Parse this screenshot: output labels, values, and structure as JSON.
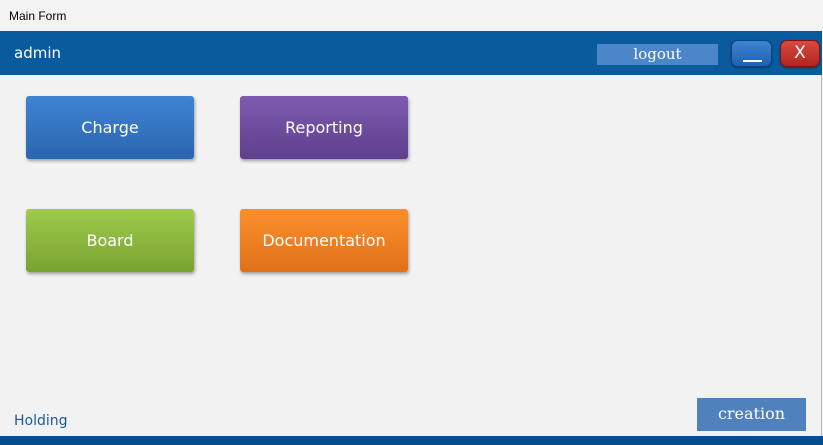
{
  "window": {
    "title": "Main Form"
  },
  "header": {
    "user": "admin",
    "logout_label": "logout",
    "close_label": "X"
  },
  "tiles": [
    {
      "label": "Charge",
      "color": "#3a78c8"
    },
    {
      "label": "Reporting",
      "color": "#6b4a9e"
    },
    {
      "label": "Board",
      "color": "#8cb840"
    },
    {
      "label": "Documentation",
      "color": "#f07e22"
    }
  ],
  "footer": {
    "holding_label": "Holding",
    "creation_label": "creation"
  },
  "colors": {
    "header_bg": "#0a5a9e",
    "button_blue": "#4f81bd",
    "close_red": "#c0332b"
  }
}
